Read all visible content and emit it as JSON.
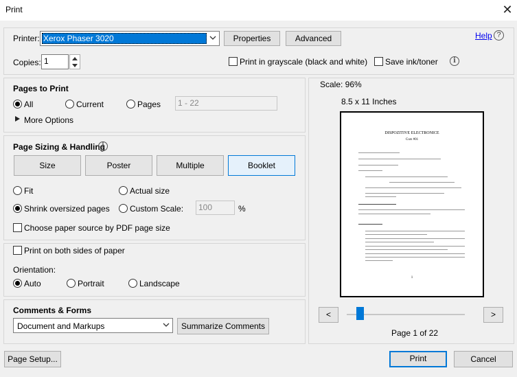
{
  "window": {
    "title": "Print",
    "close_glyph": "✕"
  },
  "printer": {
    "label": "Printer:",
    "selected": "Xerox Phaser 3020",
    "properties_label": "Properties",
    "advanced_label": "Advanced",
    "help_label": "Help",
    "help_icon": "?"
  },
  "copies": {
    "label": "Copies:",
    "value": "1"
  },
  "options": {
    "grayscale_label": "Print in grayscale (black and white)",
    "save_ink_label": "Save ink/toner"
  },
  "pages_to_print": {
    "heading": "Pages to Print",
    "all_label": "All",
    "current_label": "Current",
    "pages_label": "Pages",
    "pages_value": "1 - 22",
    "more_options_label": "More Options"
  },
  "sizing": {
    "heading": "Page Sizing & Handling",
    "tabs": [
      "Size",
      "Poster",
      "Multiple",
      "Booklet"
    ],
    "fit_label": "Fit",
    "actual_label": "Actual size",
    "shrink_label": "Shrink oversized pages",
    "custom_label": "Custom Scale:",
    "custom_value": "100",
    "percent": "%",
    "paper_source_label": "Choose paper source by PDF page size"
  },
  "duplex": {
    "both_sides_label": "Print on both sides of paper"
  },
  "orientation": {
    "heading": "Orientation:",
    "auto_label": "Auto",
    "portrait_label": "Portrait",
    "landscape_label": "Landscape"
  },
  "comments": {
    "heading": "Comments & Forms",
    "selected": "Document and Markups",
    "summarize_label": "Summarize Comments"
  },
  "preview": {
    "scale_label": "Scale:  96%",
    "paper_size": "8.5 x 11 Inches",
    "prev_label": "<",
    "next_label": ">",
    "page_indicator": "Page 1 of 22",
    "doc_title": "DISPOZITIVE ELECTRONICE",
    "doc_subtitle": "Curs #01",
    "doc_page_number": "1"
  },
  "footer": {
    "page_setup_label": "Page Setup...",
    "print_label": "Print",
    "cancel_label": "Cancel"
  }
}
